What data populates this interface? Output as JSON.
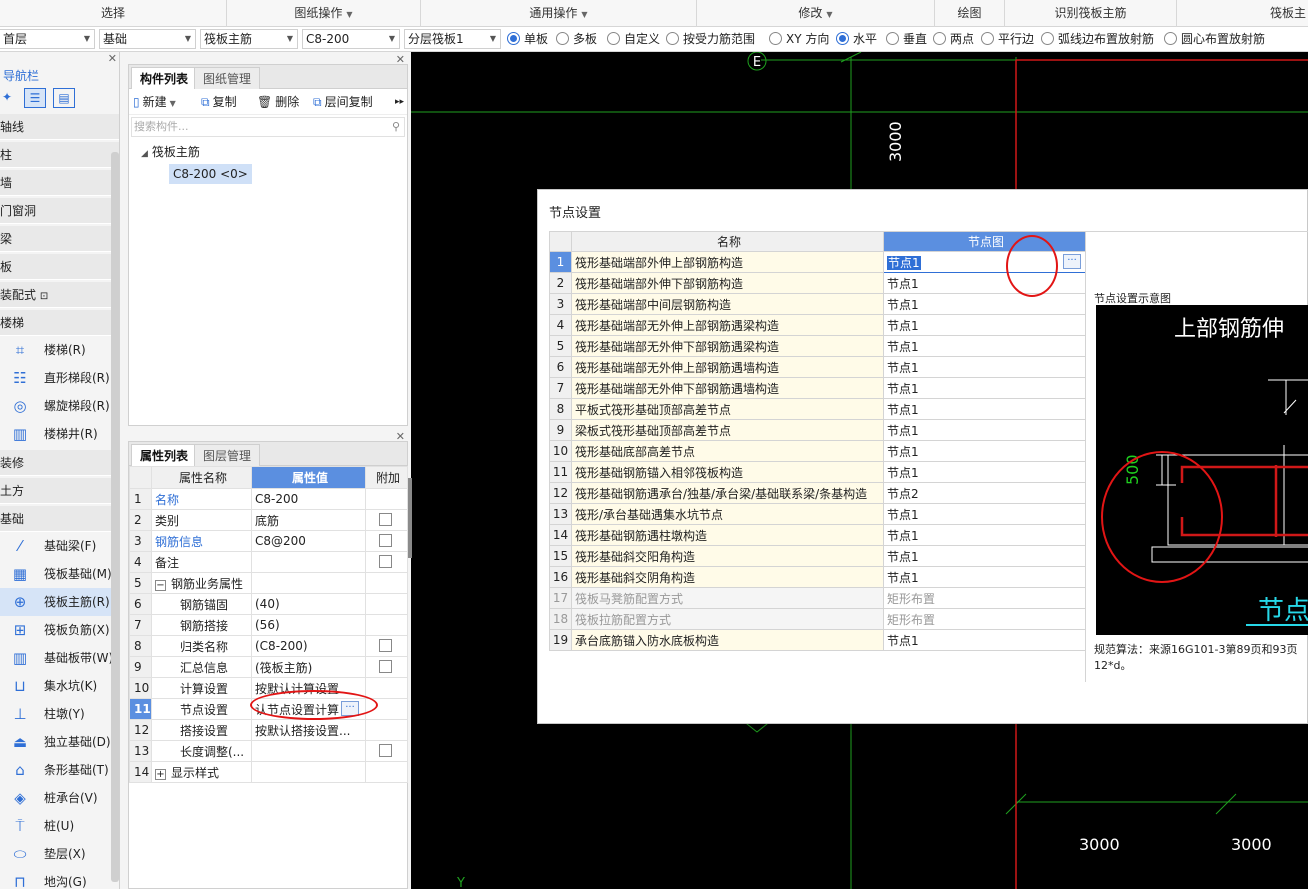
{
  "ribbon": {
    "groups": [
      {
        "label": "选择",
        "dropdown": false
      },
      {
        "label": "图纸操作",
        "dropdown": true
      },
      {
        "label": "通用操作",
        "dropdown": true
      },
      {
        "label": "修改",
        "dropdown": true
      },
      {
        "label": "绘图",
        "dropdown": false
      },
      {
        "label": "识别筏板主筋",
        "dropdown": false
      },
      {
        "label": "筏板主",
        "dropdown": false
      }
    ]
  },
  "toolbar": {
    "floor": "首层",
    "category": "基础",
    "type": "筏板主筋",
    "spec": "C8-200",
    "layer": "分层筏板1",
    "radios": [
      {
        "label": "单板",
        "checked": true
      },
      {
        "label": "多板",
        "checked": false
      },
      {
        "label": "自定义",
        "checked": false
      },
      {
        "label": "按受力筋范围",
        "checked": false
      },
      {
        "label": "XY 方向",
        "checked": false
      },
      {
        "label": "水平",
        "checked": true
      },
      {
        "label": "垂直",
        "checked": false
      },
      {
        "label": "两点",
        "checked": false
      },
      {
        "label": "平行边",
        "checked": false
      },
      {
        "label": "弧线边布置放射筋",
        "checked": false
      },
      {
        "label": "圆心布置放射筋",
        "checked": false
      }
    ]
  },
  "nav": {
    "title": "导航栏",
    "sections": [
      "轴线",
      "柱",
      "墙",
      "门窗洞",
      "梁",
      "板",
      "装配式",
      "楼梯"
    ],
    "stairs": [
      "楼梯(R)",
      "直形梯段(R)",
      "螺旋梯段(R)",
      "楼梯井(R)"
    ],
    "sections2": [
      "装修",
      "土方",
      "基础"
    ],
    "foundation": [
      "基础梁(F)",
      "筏板基础(M)",
      "筏板主筋(R)",
      "筏板负筋(X)",
      "基础板带(W)",
      "集水坑(K)",
      "柱墩(Y)",
      "独立基础(D)",
      "条形基础(T)",
      "桩承台(V)",
      "桩(U)",
      "垫层(X)",
      "地沟(G)"
    ]
  },
  "component_panel": {
    "tabs": [
      "构件列表",
      "图纸管理"
    ],
    "buttons": [
      "新建",
      "复制",
      "删除",
      "层间复制"
    ],
    "search_placeholder": "搜索构件...",
    "tree_root": "筏板主筋",
    "tree_child": "C8-200 <0>"
  },
  "property_panel": {
    "tabs": [
      "属性列表",
      "图层管理"
    ],
    "headers": [
      "属性名称",
      "属性值",
      "附加"
    ],
    "rows": [
      {
        "idx": "1",
        "name": "名称",
        "value": "C8-200",
        "check": false,
        "blue": true
      },
      {
        "idx": "2",
        "name": "类别",
        "value": "底筋",
        "check": true,
        "blue": false
      },
      {
        "idx": "3",
        "name": "钢筋信息",
        "value": "C8@200",
        "check": true,
        "blue": true
      },
      {
        "idx": "4",
        "name": "备注",
        "value": "",
        "check": true,
        "blue": false
      },
      {
        "idx": "5",
        "name": "钢筋业务属性",
        "value": "",
        "check": false,
        "blue": false
      },
      {
        "idx": "6",
        "name": "钢筋锚固",
        "value": "(40)",
        "check": false,
        "blue": false
      },
      {
        "idx": "7",
        "name": "钢筋搭接",
        "value": "(56)",
        "check": false,
        "blue": false
      },
      {
        "idx": "8",
        "name": "归类名称",
        "value": "(C8-200)",
        "check": true,
        "blue": false
      },
      {
        "idx": "9",
        "name": "汇总信息",
        "value": "(筏板主筋)",
        "check": true,
        "blue": false
      },
      {
        "idx": "10",
        "name": "计算设置",
        "value": "按默认计算设置",
        "check": false,
        "blue": false
      },
      {
        "idx": "11",
        "name": "节点设置",
        "value": "认节点设置计算",
        "check": false,
        "blue": false
      },
      {
        "idx": "12",
        "name": "搭接设置",
        "value": "按默认搭接设置...",
        "check": false,
        "blue": false
      },
      {
        "idx": "13",
        "name": "长度调整(...",
        "value": "",
        "check": true,
        "blue": false
      },
      {
        "idx": "14",
        "name": "显示样式",
        "value": "",
        "check": false,
        "blue": false
      }
    ]
  },
  "canvas": {
    "axis_label_top": "E",
    "dim_vertical": "3000",
    "dim_bottom_1": "3000",
    "dim_bottom_2": "3000",
    "axis_y": "Y"
  },
  "dialog": {
    "title": "节点设置",
    "headers": [
      "名称",
      "节点图"
    ],
    "rows": [
      {
        "idx": "1",
        "name": "筏形基础端部外伸上部钢筋构造",
        "value": "节点1",
        "disabled": false
      },
      {
        "idx": "2",
        "name": "筏形基础端部外伸下部钢筋构造",
        "value": "节点1",
        "disabled": false
      },
      {
        "idx": "3",
        "name": "筏形基础端部中间层钢筋构造",
        "value": "节点1",
        "disabled": false
      },
      {
        "idx": "4",
        "name": "筏形基础端部无外伸上部钢筋遇梁构造",
        "value": "节点1",
        "disabled": false
      },
      {
        "idx": "5",
        "name": "筏形基础端部无外伸下部钢筋遇梁构造",
        "value": "节点1",
        "disabled": false
      },
      {
        "idx": "6",
        "name": "筏形基础端部无外伸上部钢筋遇墙构造",
        "value": "节点1",
        "disabled": false
      },
      {
        "idx": "7",
        "name": "筏形基础端部无外伸下部钢筋遇墙构造",
        "value": "节点1",
        "disabled": false
      },
      {
        "idx": "8",
        "name": "平板式筏形基础顶部高差节点",
        "value": "节点1",
        "disabled": false
      },
      {
        "idx": "9",
        "name": "梁板式筏形基础顶部高差节点",
        "value": "节点1",
        "disabled": false
      },
      {
        "idx": "10",
        "name": "筏形基础底部高差节点",
        "value": "节点1",
        "disabled": false
      },
      {
        "idx": "11",
        "name": "筏形基础钢筋锚入相邻筏板构造",
        "value": "节点1",
        "disabled": false
      },
      {
        "idx": "12",
        "name": "筏形基础钢筋遇承台/独基/承台梁/基础联系梁/条基构造",
        "value": "节点2",
        "disabled": false
      },
      {
        "idx": "13",
        "name": "筏形/承台基础遇集水坑节点",
        "value": "节点1",
        "disabled": false
      },
      {
        "idx": "14",
        "name": "筏形基础钢筋遇柱墩构造",
        "value": "节点1",
        "disabled": false
      },
      {
        "idx": "15",
        "name": "筏形基础斜交阳角构造",
        "value": "节点1",
        "disabled": false
      },
      {
        "idx": "16",
        "name": "筏形基础斜交阴角构造",
        "value": "节点1",
        "disabled": false
      },
      {
        "idx": "17",
        "name": "筏板马凳筋配置方式",
        "value": "矩形布置",
        "disabled": true
      },
      {
        "idx": "18",
        "name": "筏板拉筋配置方式",
        "value": "矩形布置",
        "disabled": true
      },
      {
        "idx": "19",
        "name": "承台底筋锚入防水底板构造",
        "value": "节点1",
        "disabled": false
      }
    ],
    "preview_title": "节点设置示意图",
    "preview_heading": "上部钢筋伸",
    "preview_dim": "500",
    "preview_caption": "节点",
    "note_line1": "规范算法：来源16G101-3第89页和93页",
    "note_line2": "12*d。"
  },
  "colors": {
    "accent": "#2f6fd6",
    "header_blue": "#5b8fe0",
    "annotation_red": "#e21515",
    "cad_green": "#1fa01f",
    "cad_red": "#d01818",
    "cad_cyan": "#27d8e8"
  }
}
